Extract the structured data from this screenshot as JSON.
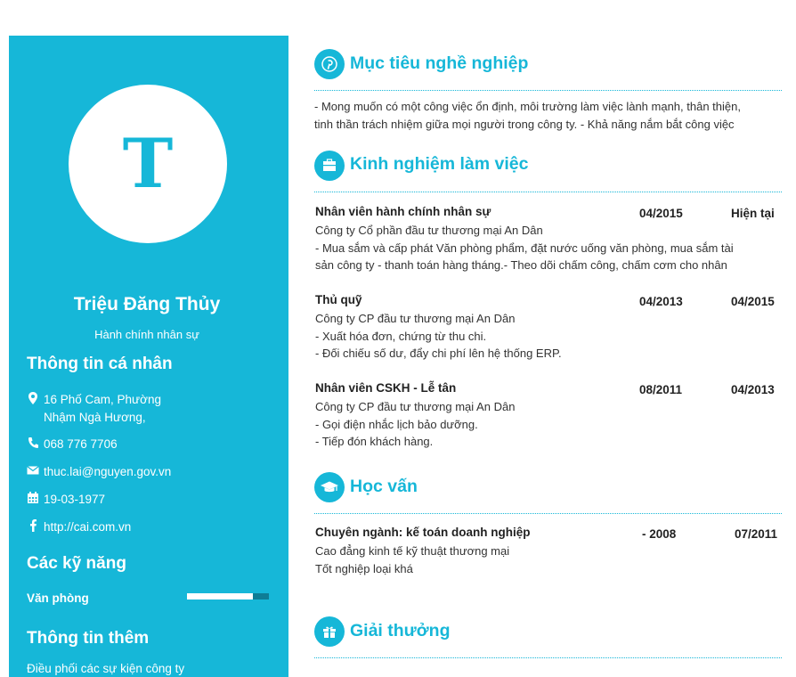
{
  "sidebar": {
    "avatar_letter": "T",
    "name": "Triệu Đăng Thủy",
    "job_title": "Hành chính nhân sự",
    "personal_heading": "Thông tin cá nhân",
    "address_line1": "16 Phố Cam, Phường",
    "address_line2": "Nhậm Ngà Hương,",
    "phone": "068 776 7706",
    "email": "thuc.lai@nguyen.gov.vn",
    "birthday": "19-03-1977",
    "website": "http://cai.com.vn",
    "skills_heading": "Các kỹ năng",
    "skills": [
      {
        "label": "Văn phòng",
        "level": 0.8
      }
    ],
    "extra_heading": "Thông tin thêm",
    "extra_text": "Điều phối các sự kiện công ty"
  },
  "objective": {
    "heading": "Mục tiêu nghề nghiệp",
    "lines": [
      "- Mong muốn có một công việc ổn định, môi trường làm việc lành mạnh, thân thiện,",
      "tinh thần trách nhiệm giữa mọi người trong công ty. - Khả năng nắm bắt công việc"
    ]
  },
  "experience": {
    "heading": "Kinh nghiệm làm việc",
    "items": [
      {
        "title": "Nhân viên hành chính nhân sự",
        "start": "04/2015",
        "end": "Hiện tại",
        "company": "Công ty Cổ phần đầu tư thương mại An Dân",
        "details": [
          "- Mua sắm và cấp phát Văn phòng phẩm, đặt nước uống văn phòng, mua sắm tài",
          "sản công ty - thanh toán hàng tháng.- Theo dõi chấm công, chấm cơm cho nhân"
        ]
      },
      {
        "title": "Thủ quỹ",
        "start": "04/2013",
        "end": "04/2015",
        "company": "Công ty CP đầu tư thương mại An Dân",
        "details": [
          "- Xuất hóa đơn, chứng từ thu chi.",
          "- Đối chiếu số dư, đẩy chi phí lên hệ thống ERP."
        ]
      },
      {
        "title": "Nhân viên CSKH - Lễ tân",
        "start": "08/2011",
        "end": "04/2013",
        "company": "Công ty CP đầu tư thương mại An Dân",
        "details": [
          "- Gọi điện nhắc lịch bảo dưỡng.",
          "- Tiếp đón khách hàng."
        ]
      }
    ]
  },
  "education": {
    "heading": "Học vấn",
    "items": [
      {
        "title": "Chuyên ngành: kế toán doanh nghiệp",
        "start": "- 2008",
        "end": "07/2011",
        "school": "Cao đẳng kinh tế kỹ thuật thương mại",
        "note": "Tốt nghiệp loại khá"
      }
    ]
  },
  "awards": {
    "heading": "Giải thưởng"
  },
  "colors": {
    "accent": "#16b7d8",
    "skill_track": "#0e7d95",
    "text": "#333333"
  },
  "icons": {
    "objective": "pinterest-icon",
    "experience": "briefcase-icon",
    "education": "graduation-cap-icon",
    "awards": "gift-icon",
    "address": "map-marker-icon",
    "phone": "phone-icon",
    "email": "envelope-icon",
    "birthday": "calendar-icon",
    "website": "facebook-icon"
  }
}
